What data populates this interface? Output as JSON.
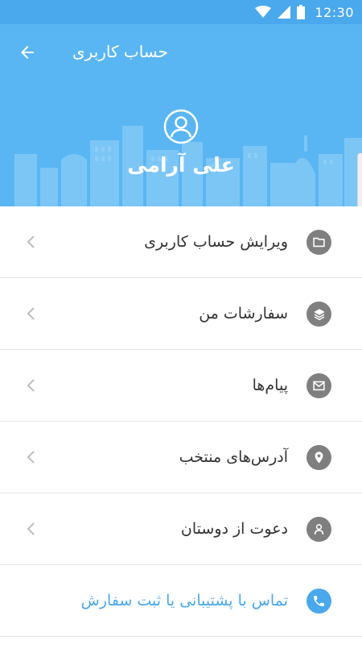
{
  "status_bar": {
    "time": "12:30",
    "icons": [
      "wifi-icon",
      "signal-icon",
      "battery-icon"
    ]
  },
  "app_bar": {
    "title": "حساب کاربری",
    "back_icon": "arrow-left-icon"
  },
  "profile": {
    "name": "علی آرامی",
    "avatar_icon": "user-circle-icon"
  },
  "menu": {
    "items": [
      {
        "label": "ویرایش حساب کاربری",
        "icon": "folder-icon"
      },
      {
        "label": "سفارشات من",
        "icon": "layers-icon"
      },
      {
        "label": "پیام‌ها",
        "icon": "mail-icon"
      },
      {
        "label": "آدرس‌های منتخب",
        "icon": "location-pin-icon"
      },
      {
        "label": "دعوت از دوستان",
        "icon": "person-icon"
      },
      {
        "label": "تماس با پشتیبانی یا ثبت سفارش",
        "icon": "phone-icon"
      }
    ]
  },
  "colors": {
    "primary": "#5ab6f3",
    "status_bar": "#4aa8ec",
    "accent_text": "#4aa8ec",
    "icon_gray": "#7f7f7f"
  }
}
